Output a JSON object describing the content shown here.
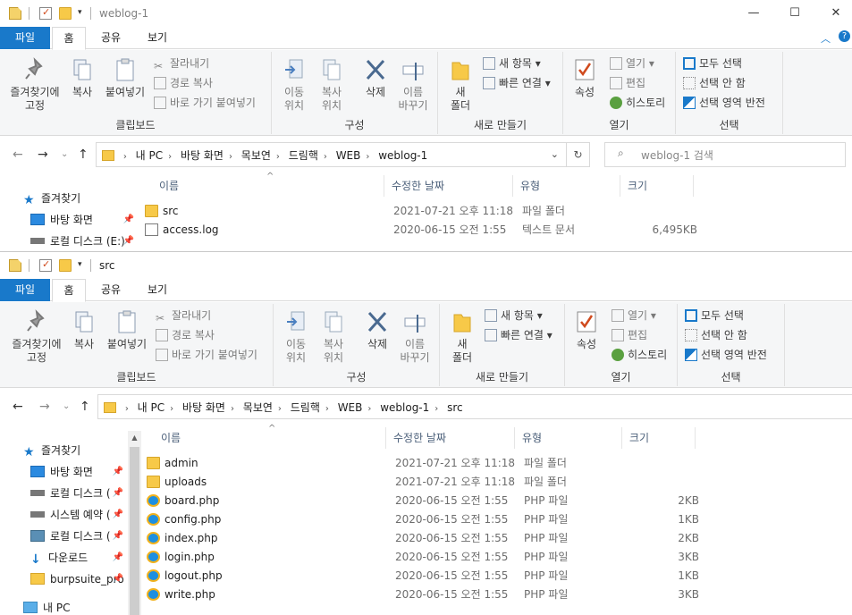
{
  "windows": [
    {
      "title": "weblog-1",
      "tabs": [
        "파일",
        "홈",
        "공유",
        "보기"
      ],
      "ribbon": {
        "clipboard": {
          "pin": "즐겨찾기에\n고정",
          "copy": "복사",
          "paste": "붙여넣기",
          "cut": "잘라내기",
          "copy_path": "경로 복사",
          "paste_shortcut": "바로 가기 붙여넣기",
          "label": "클립보드"
        },
        "organize": {
          "move": "이동\n위치",
          "copyto": "복사\n위치",
          "delete": "삭제",
          "rename": "이름\n바꾸기",
          "label": "구성"
        },
        "new": {
          "folder": "새\n폴더",
          "new_item": "새 항목",
          "easy_access": "빠른 연결",
          "label": "새로 만들기"
        },
        "open": {
          "properties": "속성",
          "open": "열기",
          "edit": "편집",
          "history": "히스토리",
          "label": "열기"
        },
        "select": {
          "all": "모두 선택",
          "none": "선택 안 함",
          "invert": "선택 영역 반전",
          "label": "선택"
        }
      },
      "breadcrumbs": [
        "내 PC",
        "바탕 화면",
        "목보연",
        "드림핵",
        "WEB",
        "weblog-1"
      ],
      "search_placeholder": "weblog-1 검색",
      "nav": [
        {
          "label": "즐겨찾기",
          "icon": "star-icon"
        },
        {
          "label": "바탕 화면",
          "icon": "desktop-icon",
          "pinned": true
        },
        {
          "label": "로컬 디스크 (E:)",
          "icon": "drive-icon",
          "pinned": true
        }
      ],
      "columns": [
        "이름",
        "수정한 날짜",
        "유형",
        "크기"
      ],
      "files": [
        {
          "name": "src",
          "date": "2021-07-21 오후 11:18",
          "type": "파일 폴더",
          "size": "",
          "icon": "folder-icon"
        },
        {
          "name": "access.log",
          "date": "2020-06-15 오전 1:55",
          "type": "텍스트 문서",
          "size": "6,495KB",
          "icon": "text-file-icon"
        }
      ]
    },
    {
      "title": "src",
      "tabs": [
        "파일",
        "홈",
        "공유",
        "보기"
      ],
      "breadcrumbs": [
        "내 PC",
        "바탕 화면",
        "목보연",
        "드림핵",
        "WEB",
        "weblog-1",
        "src"
      ],
      "nav": [
        {
          "label": "즐겨찾기",
          "icon": "star-icon"
        },
        {
          "label": "바탕 화면",
          "icon": "desktop-icon",
          "pinned": true
        },
        {
          "label": "로컬 디스크 (",
          "icon": "drive-icon",
          "pinned": true
        },
        {
          "label": "시스템 예약 (",
          "icon": "drive-icon",
          "pinned": true
        },
        {
          "label": "로컬 디스크 (",
          "icon": "network-drive-icon",
          "pinned": true
        },
        {
          "label": "다운로드",
          "icon": "download-icon",
          "pinned": true
        },
        {
          "label": "burpsuite_pro",
          "icon": "folder-icon",
          "pinned": true
        },
        {
          "label": "내 PC",
          "icon": "pc-icon"
        }
      ],
      "columns": [
        "이름",
        "수정한 날짜",
        "유형",
        "크기"
      ],
      "files": [
        {
          "name": "admin",
          "date": "2021-07-21 오후 11:18",
          "type": "파일 폴더",
          "size": "",
          "icon": "folder-icon"
        },
        {
          "name": "uploads",
          "date": "2021-07-21 오후 11:18",
          "type": "파일 폴더",
          "size": "",
          "icon": "folder-icon"
        },
        {
          "name": "board.php",
          "date": "2020-06-15 오전 1:55",
          "type": "PHP 파일",
          "size": "2KB",
          "icon": "php-file-icon"
        },
        {
          "name": "config.php",
          "date": "2020-06-15 오전 1:55",
          "type": "PHP 파일",
          "size": "1KB",
          "icon": "php-file-icon"
        },
        {
          "name": "index.php",
          "date": "2020-06-15 오전 1:55",
          "type": "PHP 파일",
          "size": "2KB",
          "icon": "php-file-icon"
        },
        {
          "name": "login.php",
          "date": "2020-06-15 오전 1:55",
          "type": "PHP 파일",
          "size": "3KB",
          "icon": "php-file-icon"
        },
        {
          "name": "logout.php",
          "date": "2020-06-15 오전 1:55",
          "type": "PHP 파일",
          "size": "1KB",
          "icon": "php-file-icon"
        },
        {
          "name": "write.php",
          "date": "2020-06-15 오전 1:55",
          "type": "PHP 파일",
          "size": "3KB",
          "icon": "php-file-icon"
        }
      ]
    }
  ],
  "colors": {
    "accent": "#1979ca",
    "folder": "#f7c948"
  }
}
